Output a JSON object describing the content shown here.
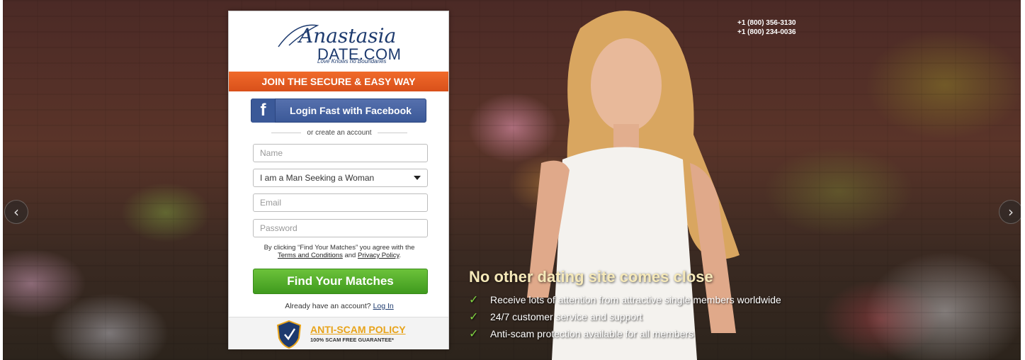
{
  "contact": {
    "phone_1": "+1 (800) 356-3130",
    "phone_2": "+1 (800) 234-0036"
  },
  "brand": {
    "script_name": "Anastasia",
    "domain_text": "DATE.COM",
    "tagline": "Love Knows no Boundaries"
  },
  "signup": {
    "banner": "JOIN THE SECURE & EASY WAY",
    "facebook_button": "Login Fast with Facebook",
    "divider_text": "or create an account",
    "name_placeholder": "Name",
    "seeking_selected": "I am a Man Seeking a Woman",
    "email_placeholder": "Email",
    "password_placeholder": "Password",
    "terms_prefix": "By clicking “Find Your Matches” you agree with the",
    "terms_link": "Terms and Conditions",
    "terms_and": "and",
    "privacy_link": "Privacy Policy",
    "terms_suffix": ".",
    "submit_button": "Find Your Matches",
    "already_text": "Already have an account?",
    "login_link": "Log In"
  },
  "anti_scam": {
    "title": "ANTI-SCAM POLICY",
    "subtitle": "100% SCAM FREE GUARANTEE*"
  },
  "promo": {
    "headline": "No other dating site comes close",
    "bullets": [
      "Receive lots of attention from attractive single members worldwide",
      "24/7 customer service and support",
      "Anti-scam protection available for all members"
    ]
  },
  "colors": {
    "accent_orange": "#e85d22",
    "cta_green": "#4fa928",
    "facebook_blue": "#3b5998",
    "brand_navy": "#1d3a6e",
    "gold": "#e8a319"
  },
  "icons": {
    "prev": "chevron-left-icon",
    "next": "chevron-right-icon",
    "bullet": "checkmark-icon"
  }
}
